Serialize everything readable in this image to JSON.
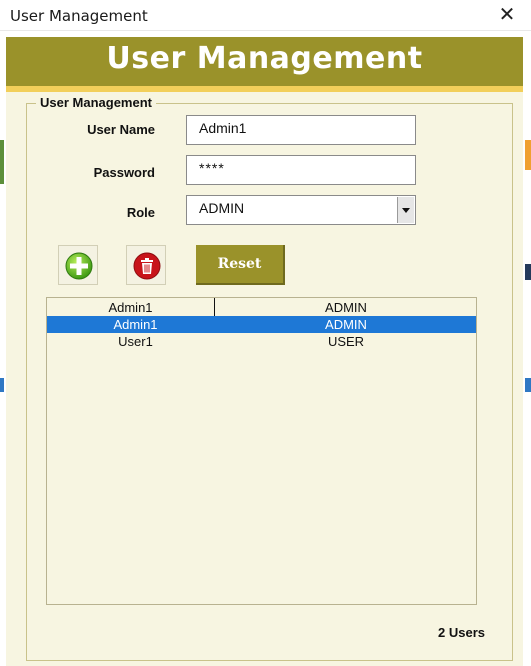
{
  "window": {
    "title": "User Management",
    "close_glyph": "✕"
  },
  "banner": {
    "title": "User Management"
  },
  "group": {
    "legend": "User Management"
  },
  "form": {
    "username_label": "User Name",
    "username_value": "Admin1",
    "password_label": "Password",
    "password_value": "****",
    "role_label": "Role",
    "role_value": "ADMIN"
  },
  "buttons": {
    "add_icon": "add-icon",
    "delete_icon": "trash-icon",
    "reset_label": "Reset"
  },
  "list": {
    "header": [
      "Admin1",
      "ADMIN"
    ],
    "rows": [
      {
        "name": "Admin1",
        "role": "ADMIN",
        "selected": true
      },
      {
        "name": "User1",
        "role": "USER",
        "selected": false
      }
    ]
  },
  "footer": {
    "count_label": "2 Users"
  },
  "colors": {
    "accent": "#9a922a",
    "banner_stripe": "#f2cf5a",
    "form_bg": "#f7f5e1",
    "selection": "#1e78d6"
  }
}
